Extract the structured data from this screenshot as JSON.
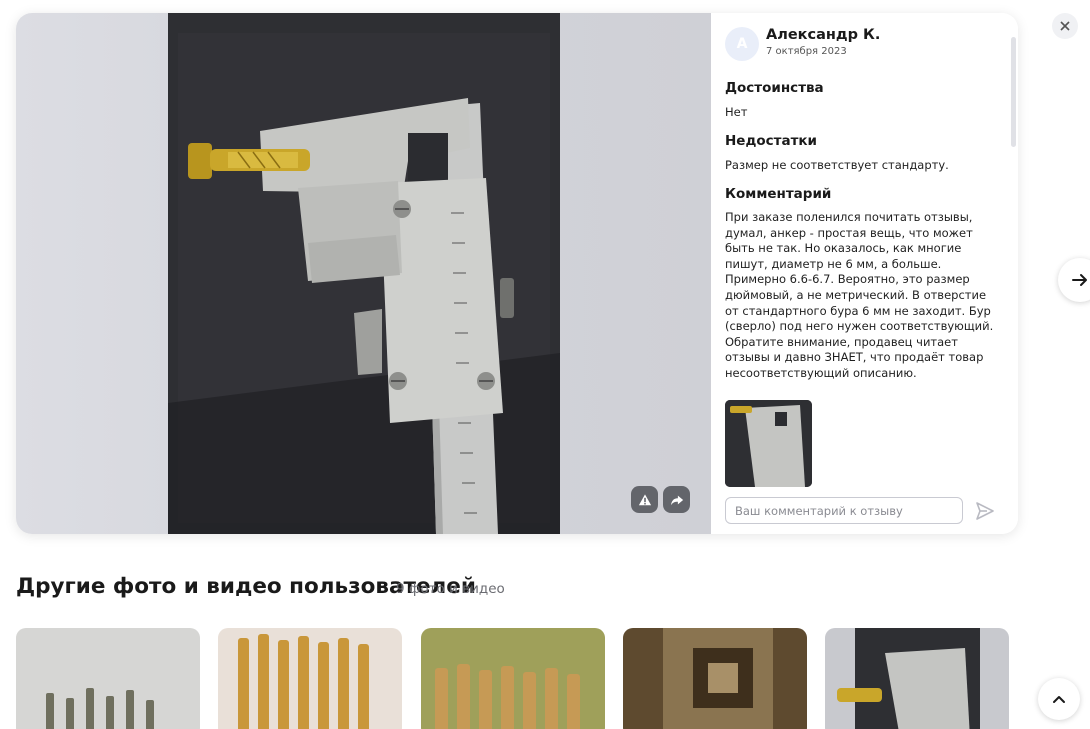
{
  "review": {
    "author_initial": "А",
    "author_name": "Александр К.",
    "date": "7 октября 2023",
    "pros_title": "Достоинства",
    "pros_text": "Нет",
    "cons_title": "Недостатки",
    "cons_text": "Размер не соответствует стандарту.",
    "comment_title": "Комментарий",
    "comment_text": "При заказе поленился почитать отзывы, думал, анкер - простая вещь, что может быть не так. Но оказалось, как многие пишут, диаметр не 6 мм, а больше. Примерно 6.6-6.7. Вероятно, это размер дюймовый, а не метрический. В отверстие от стандартного бура 6 мм не заходит. Бур (сверло) под него нужен соответствующий. Обратите внимание, продавец читает отзывы и давно ЗНАЕТ, что продаёт товар несоответствующий описанию.",
    "comment_placeholder": "Ваш комментарий к отзыву"
  },
  "other_media": {
    "title": "Другие фото и видео пользователей",
    "count": "9 фото и видео"
  },
  "icons": {
    "close": "close-icon",
    "next": "arrow-right-icon",
    "report": "warning-icon",
    "share": "share-icon",
    "send": "send-icon",
    "scroll_top": "chevron-up-icon"
  },
  "colors": {
    "avatar_bg": "#e9eef9",
    "text": "#1a1a1a",
    "muted": "#6b6c72"
  }
}
